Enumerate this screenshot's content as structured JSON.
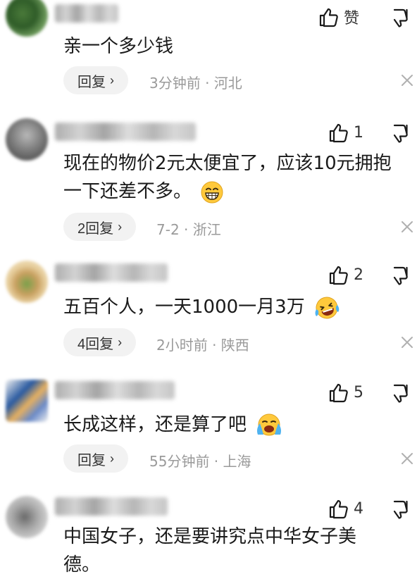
{
  "comments": [
    {
      "like_label": "赞",
      "content": "亲一个多少钱",
      "reply_label": "回复",
      "meta": "3分钟前 · 河北",
      "emoji": ""
    },
    {
      "like_label": "1",
      "content_line1": "现在的物价2元太便宜了，应该10元拥抱",
      "content_line2": "一下还差不多。",
      "reply_label": "2回复",
      "meta": "7-2 · 浙江",
      "emoji": "grin-emoji"
    },
    {
      "like_label": "2",
      "content": "五百个人，一天1000一月3万",
      "reply_label": "4回复",
      "meta": "2小时前 · 陕西",
      "emoji": "laugh-tears-emoji"
    },
    {
      "like_label": "5",
      "content": "长成这样，还是算了吧",
      "reply_label": "回复",
      "meta": "55分钟前 · 上海",
      "emoji": "crying-emoji"
    },
    {
      "like_label": "4",
      "content_line1": "中国女子，还是要讲究点中华女子美",
      "content_line2": "德。",
      "reply_label": "",
      "meta": "",
      "emoji": ""
    }
  ],
  "icons": {
    "like": "thumbs-up-icon",
    "dislike": "thumbs-down-icon",
    "close": "close-icon",
    "chevron": "chevron-right-icon"
  },
  "colors": {
    "text": "#1a1a1a",
    "meta": "#9a9a9a",
    "pill_bg": "#f2f2f2",
    "emoji_yellow": "#ffc93c"
  }
}
